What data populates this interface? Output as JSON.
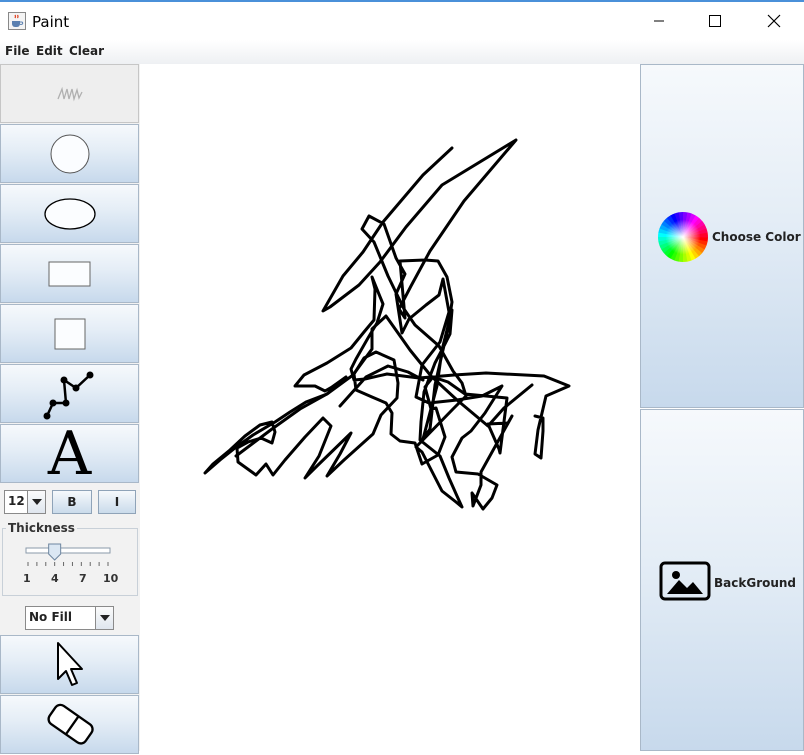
{
  "window": {
    "title": "Paint",
    "app_icon": "java-cup-icon"
  },
  "menu": {
    "file": "File",
    "edit": "Edit",
    "clear": "Clear"
  },
  "tools": [
    {
      "name": "freehand",
      "icon": "scribble-icon",
      "selected": true
    },
    {
      "name": "circle",
      "icon": "circle-icon"
    },
    {
      "name": "ellipse",
      "icon": "ellipse-icon"
    },
    {
      "name": "rectangle",
      "icon": "rectangle-icon"
    },
    {
      "name": "square",
      "icon": "square-icon"
    },
    {
      "name": "polyline",
      "icon": "polyline-icon"
    },
    {
      "name": "text",
      "icon": "text-icon",
      "glyph": "A"
    }
  ],
  "font_controls": {
    "size": "12",
    "bold_label": "B",
    "italic_label": "I"
  },
  "thickness": {
    "label": "Thickness",
    "value": 4,
    "min": 1,
    "max": 10,
    "ticks": [
      "1",
      "4",
      "7",
      "10"
    ]
  },
  "fill": {
    "selected": "No Fill"
  },
  "bottom_tools": [
    {
      "name": "select",
      "icon": "cursor-arrow-icon"
    },
    {
      "name": "eraser",
      "icon": "eraser-icon"
    }
  ],
  "right_panel": {
    "choose_color_label": "Choose Color",
    "choose_color_icon": "color-wheel-icon",
    "background_label": "BackGround",
    "background_icon": "image-icon"
  },
  "colors": {
    "stroke": "#000000",
    "canvas": "#ffffff",
    "button_top": "#f6f9fc",
    "button_bottom": "#c7d9ec"
  }
}
